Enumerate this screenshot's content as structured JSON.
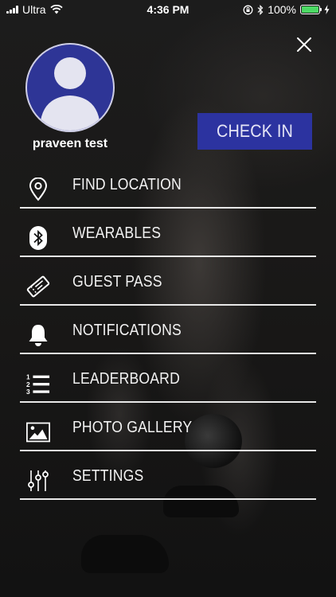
{
  "status_bar": {
    "carrier": "Ultra",
    "time": "4:36 PM",
    "battery_percent": "100%",
    "battery_level": 1.0,
    "battery_color": "#4cd964"
  },
  "profile": {
    "name": "praveen test",
    "avatar_icon": "default-user-avatar-icon",
    "avatar_color": "#2e3596"
  },
  "check_in_label": "CHECK IN",
  "check_in_color": "#2c33a0",
  "close_icon": "close-icon",
  "menu": [
    {
      "label": "FIND LOCATION",
      "icon": "location-pin-icon"
    },
    {
      "label": "WEARABLES",
      "icon": "bluetooth-icon"
    },
    {
      "label": "GUEST PASS",
      "icon": "ticket-icon"
    },
    {
      "label": "NOTIFICATIONS",
      "icon": "bell-icon"
    },
    {
      "label": "LEADERBOARD",
      "icon": "numbered-list-icon"
    },
    {
      "label": "PHOTO GALLERY",
      "icon": "image-icon"
    },
    {
      "label": "SETTINGS",
      "icon": "sliders-icon"
    }
  ]
}
